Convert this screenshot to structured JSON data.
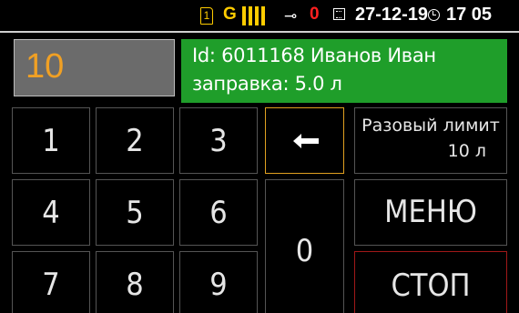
{
  "status_bar": {
    "sim_label": "1",
    "network_label": "G",
    "signal_bars": 4,
    "signal_bars_max": 4,
    "key_icon": "key-icon",
    "key_count": "0",
    "calendar_icon": "calendar-icon",
    "date": "27-12-19",
    "clock_icon": "clock-icon",
    "time": "17 05"
  },
  "display": {
    "value": "10"
  },
  "info": {
    "line1": "Id: 6011168  Иванов Иван",
    "line2": "заправка:  5.0 л"
  },
  "keypad": {
    "k1": "1",
    "k2": "2",
    "k3": "3",
    "k4": "4",
    "k5": "5",
    "k6": "6",
    "k7": "7",
    "k8": "8",
    "k9": "9",
    "k0": "0",
    "backspace_icon": "backspace-arrow-icon"
  },
  "actions": {
    "limit_line1": "Разовый лимит",
    "limit_line2": "10 л",
    "menu": "МЕНЮ",
    "stop": "СТОП"
  },
  "colors": {
    "background": "#000000",
    "accent_yellow": "#ffcc00",
    "info_green": "#1f9e2a",
    "display_value": "#f0a024",
    "alert_red": "#ff2020"
  }
}
